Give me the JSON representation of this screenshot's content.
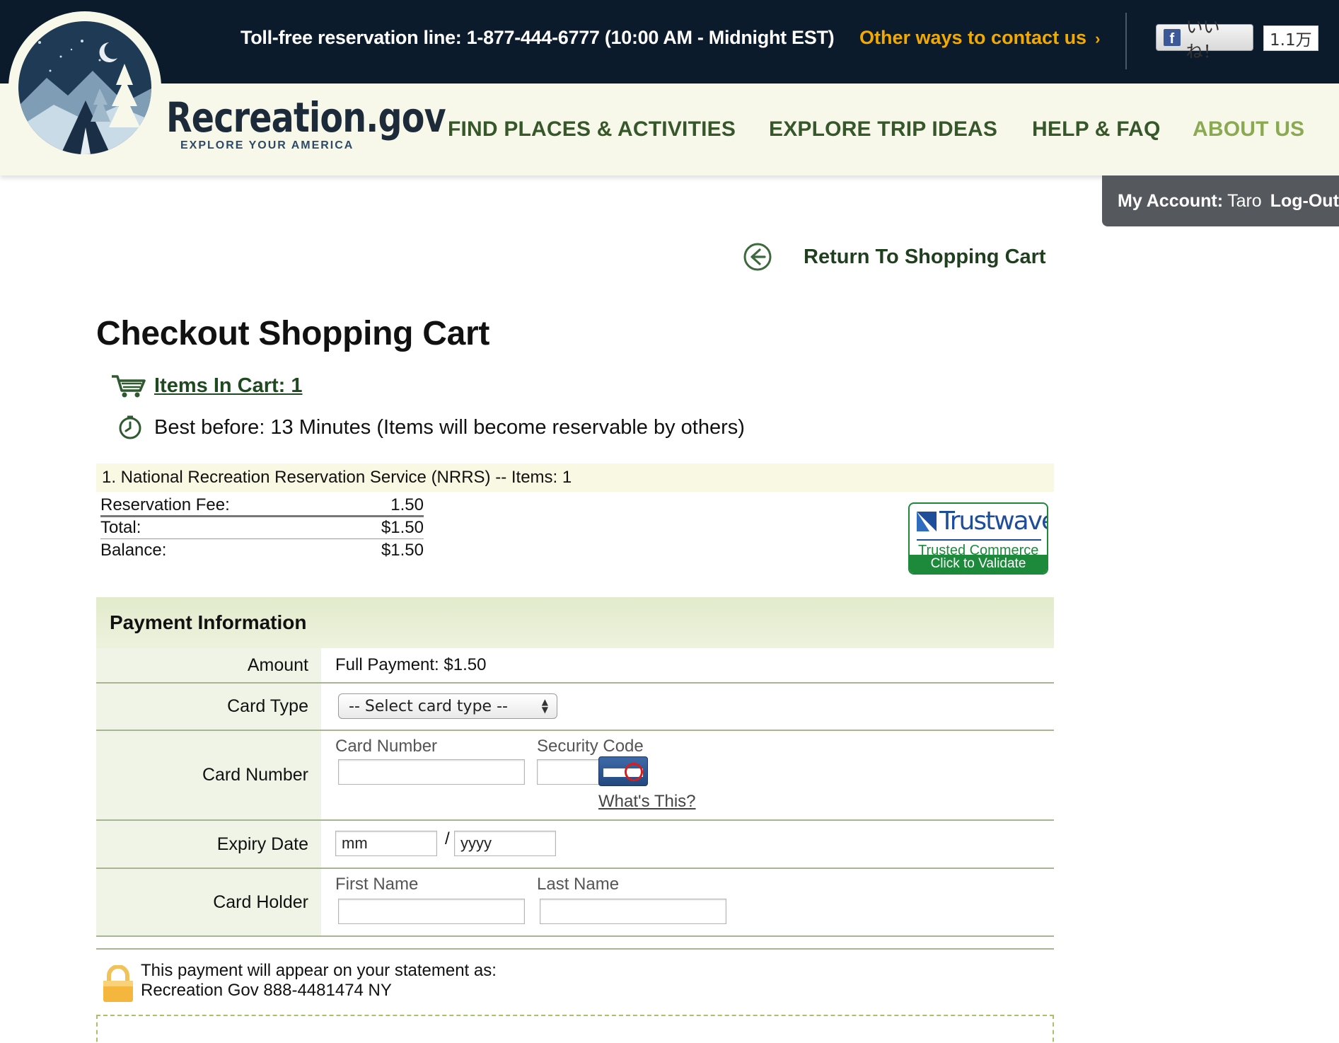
{
  "topbar": {
    "phone": "Toll-free reservation line: 1-877-444-6777 (10:00 AM - Midnight EST)",
    "contact_link": "Other ways to contact us",
    "fb_like_label": "いいね！",
    "fb_like_count": "1.1万"
  },
  "brand": {
    "name": "Recreation",
    "suffix": ".gov",
    "tagline": "EXPLORE YOUR AMERICA"
  },
  "nav": [
    {
      "label": "FIND PLACES & ACTIVITIES"
    },
    {
      "label": "EXPLORE TRIP IDEAS"
    },
    {
      "label": "HELP & FAQ"
    },
    {
      "label": "ABOUT US"
    }
  ],
  "account": {
    "label": "My Account:",
    "user": "Taro",
    "logout": "Log-Out"
  },
  "return_link": "Return To Shopping Cart",
  "page_title": "Checkout Shopping Cart",
  "cart": {
    "items_link": "Items In Cart: 1",
    "best_before": "Best before: 13 Minutes (Items will become reservable by others)"
  },
  "order": {
    "header": "1. National Recreation Reservation Service (NRRS) -- Items: 1",
    "fees": [
      {
        "label": "Reservation Fee:",
        "value": "1.50"
      },
      {
        "label": "Total:",
        "value": "$1.50"
      },
      {
        "label": "Balance:",
        "value": "$1.50"
      }
    ]
  },
  "trustwave": {
    "name": "Trustwave",
    "subtitle": "Trusted Commerce",
    "button": "Click to Validate"
  },
  "payment": {
    "title": "Payment Information",
    "amount_label": "Amount",
    "amount_value": "Full Payment: $1.50",
    "card_type_label": "Card Type",
    "card_type_selected": "-- Select card type --",
    "card_number_label": "Card Number",
    "card_number_field_label": "Card Number",
    "security_code_label": "Security Code",
    "whats_this": "What's This?",
    "expiry_label": "Expiry Date",
    "expiry_month": "mm",
    "expiry_slash": "/",
    "expiry_year": "yyyy",
    "holder_label": "Card Holder",
    "first_name_label": "First Name",
    "last_name_label": "Last Name"
  },
  "statement": {
    "line1": "This payment will appear on your statement as:",
    "line2": "Recreation Gov 888-4481474 NY"
  },
  "colors": {
    "topbar": "#0b1b2b",
    "header": "#f7f7ea",
    "nav": "#36572a",
    "nav_active": "#8aaa52",
    "contact_link": "#f2a900"
  }
}
